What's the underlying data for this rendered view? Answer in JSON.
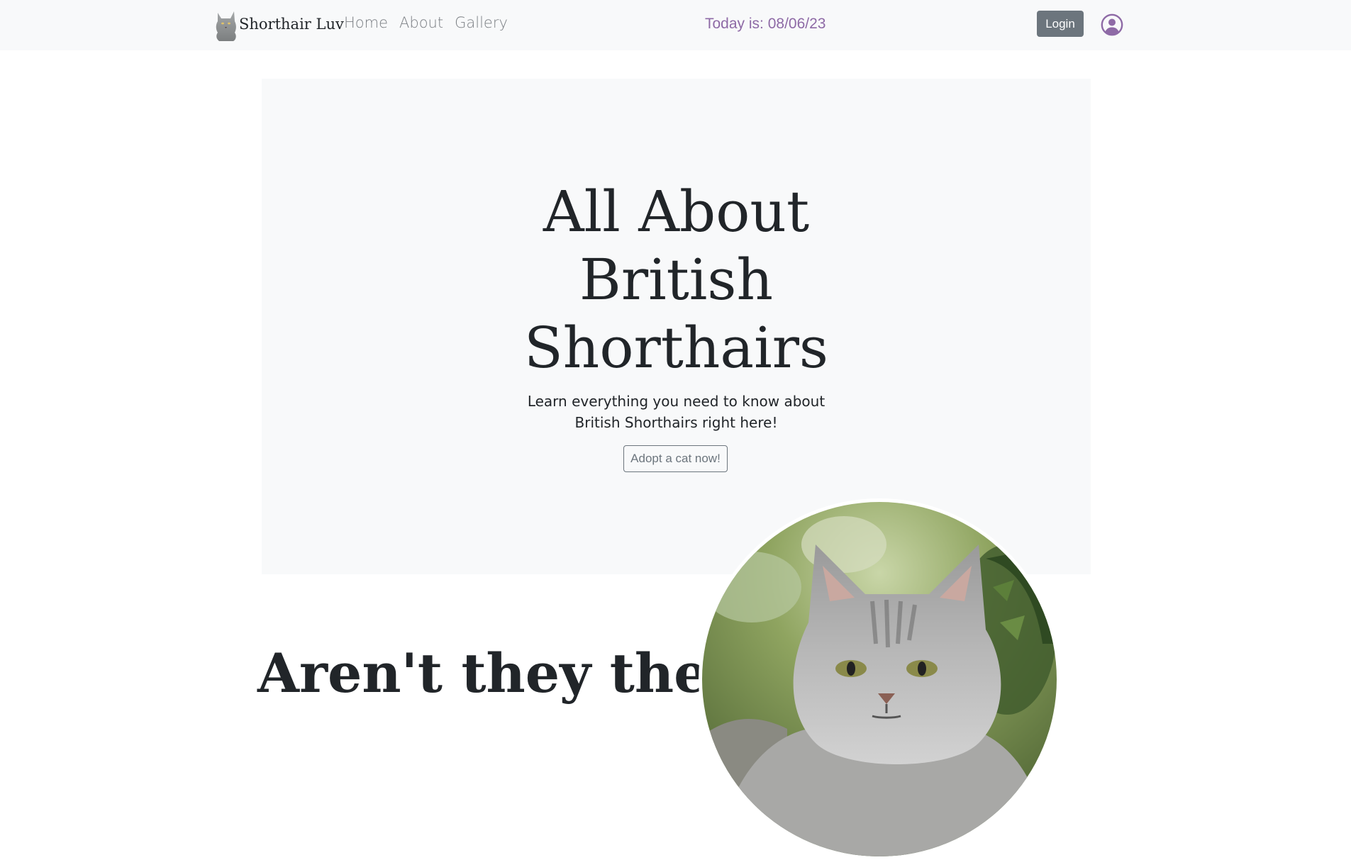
{
  "navbar": {
    "brand_text": "Shorthair Luv",
    "brand_logo_icon": "cat-logo-icon",
    "links": [
      {
        "label": "Home"
      },
      {
        "label": "About"
      },
      {
        "label": "Gallery"
      }
    ],
    "date_text": "Today is: 08/06/23",
    "login_label": "Login",
    "user_icon": "user-circle-icon"
  },
  "hero": {
    "title_lines": [
      "All About",
      "British",
      "Shorthairs"
    ],
    "subtitle_lines": [
      "Learn everything you need to know about",
      "British Shorthairs right here!"
    ],
    "cta_label": "Adopt a cat now!"
  },
  "section": {
    "heading": "Aren't they the"
  },
  "colors": {
    "navbar_bg": "#f8f9fa",
    "hero_bg": "#f8f9fa",
    "date_text": "#8e6aa6",
    "login_bg": "#6c757d",
    "outline_btn": "#6c757d"
  }
}
